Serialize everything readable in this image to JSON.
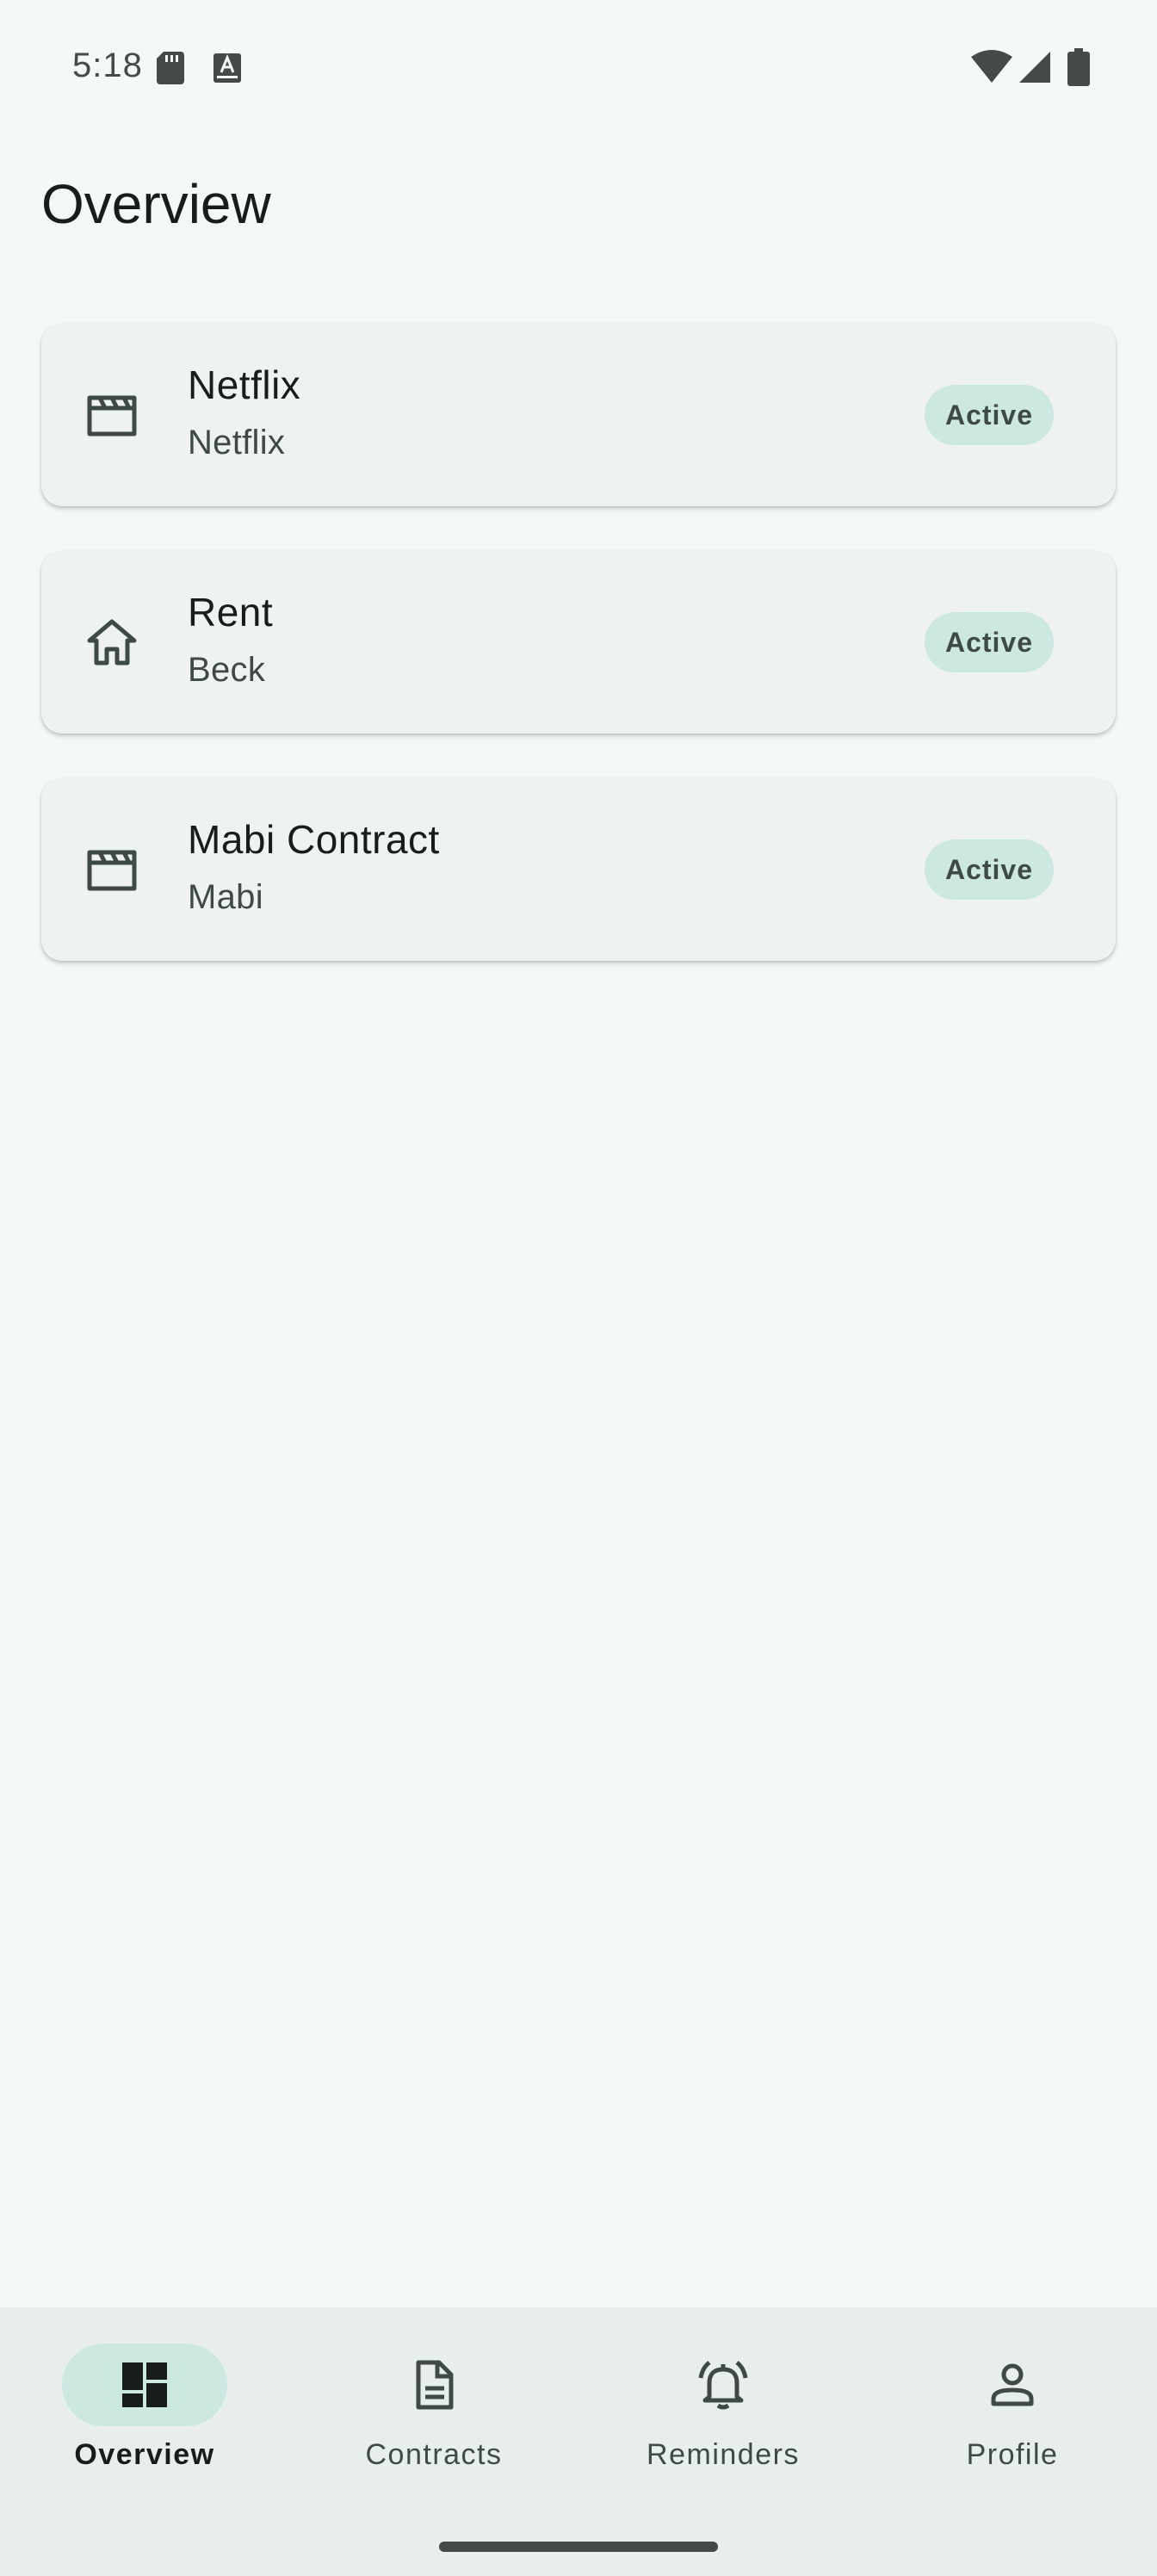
{
  "status_bar": {
    "time": "5:18",
    "icons": [
      "sd-card-icon",
      "keyboard-a-icon",
      "wifi-icon",
      "signal-icon",
      "battery-icon"
    ]
  },
  "page": {
    "title": "Overview"
  },
  "contracts": [
    {
      "title": "Netflix",
      "subtitle": "Netflix",
      "status": "Active",
      "icon": "movie-clapper-icon"
    },
    {
      "title": "Rent",
      "subtitle": "Beck",
      "status": "Active",
      "icon": "home-icon"
    },
    {
      "title": "Mabi Contract",
      "subtitle": "Mabi",
      "status": "Active",
      "icon": "movie-clapper-icon"
    }
  ],
  "bottom_nav": {
    "items": [
      {
        "label": "Overview",
        "icon": "dashboard-icon",
        "active": true
      },
      {
        "label": "Contracts",
        "icon": "document-icon",
        "active": false
      },
      {
        "label": "Reminders",
        "icon": "bell-ring-icon",
        "active": false
      },
      {
        "label": "Profile",
        "icon": "person-icon",
        "active": false
      }
    ]
  },
  "colors": {
    "background": "#f4f9f7",
    "card": "#eef3f1",
    "badge": "#cce8e1",
    "nav_background": "#e8eeec",
    "active_indicator": "#cce8e1"
  }
}
